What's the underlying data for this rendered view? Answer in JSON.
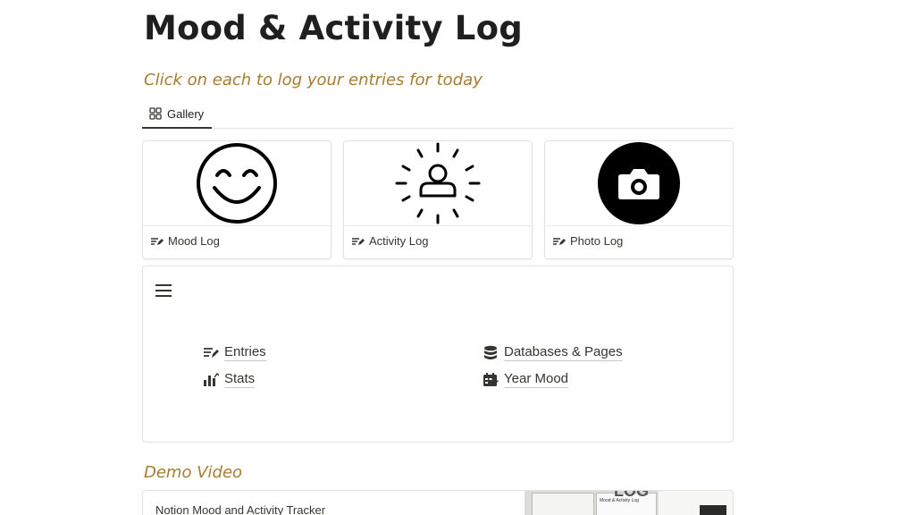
{
  "page": {
    "title": "Mood & Activity Log",
    "subtitle": "Click on each to log your entries for today"
  },
  "tabs": [
    {
      "label": "Gallery",
      "icon": "gallery-grid-icon"
    }
  ],
  "gallery": [
    {
      "label": "Mood Log",
      "icon": "smiley-face-icon"
    },
    {
      "label": "Activity Log",
      "icon": "person-radiant-icon"
    },
    {
      "label": "Photo Log",
      "icon": "camera-icon"
    }
  ],
  "menu": {
    "icon": "hamburger-menu-icon",
    "links": [
      {
        "label": "Entries",
        "icon": "entries-list-icon"
      },
      {
        "label": "Stats",
        "icon": "stats-chart-icon"
      },
      {
        "label": "Databases & Pages",
        "icon": "database-icon"
      },
      {
        "label": "Year Mood",
        "icon": "calendar-icon"
      }
    ]
  },
  "demo": {
    "section_title": "Demo Video",
    "video_title": "Notion Mood and Activity Tracker",
    "thumb_text": "Mood & Activity Log",
    "thumb_heading": "LOG"
  },
  "colors": {
    "accent": "#a87b2f",
    "text": "#37352f",
    "border": "#e2e2e0"
  }
}
